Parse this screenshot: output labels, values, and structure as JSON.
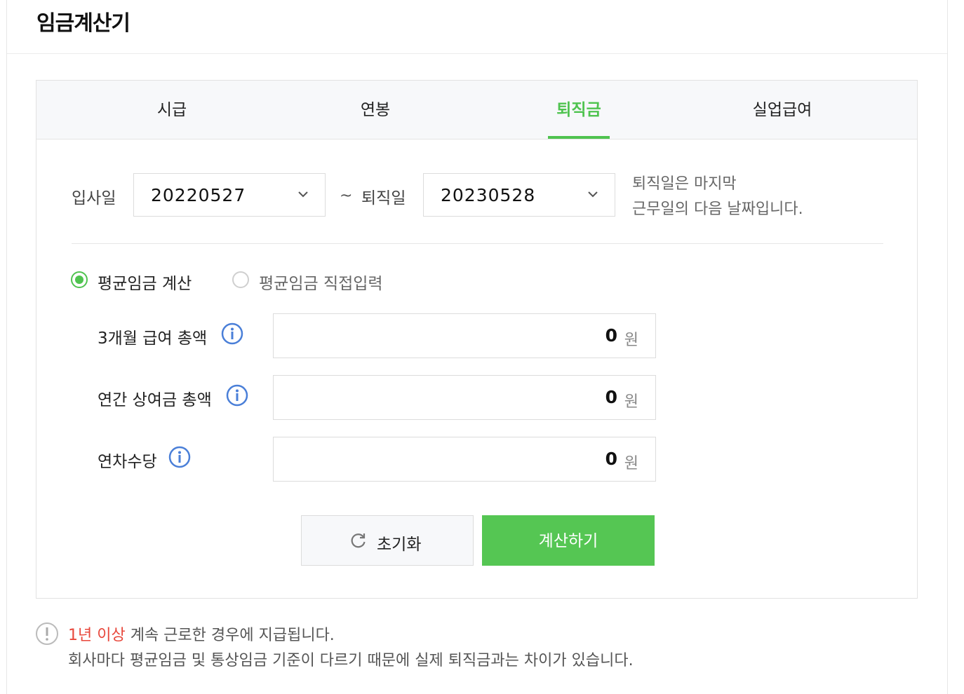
{
  "title": "임금계산기",
  "tabs": [
    {
      "label": "시급",
      "active": false
    },
    {
      "label": "연봉",
      "active": false
    },
    {
      "label": "퇴직금",
      "active": true
    },
    {
      "label": "실업급여",
      "active": false
    }
  ],
  "dates": {
    "start_label": "입사일",
    "start_value": "20220527",
    "tilde": "~",
    "end_label": "퇴직일",
    "end_value": "20230528",
    "note_line1": "퇴직일은 마지막",
    "note_line2": "근무일의 다음 날짜입니다."
  },
  "mode": {
    "option1": "평균임금 계산",
    "option2": "평균임금 직접입력",
    "selected": "option1"
  },
  "fields": [
    {
      "label": "3개월 급여 총액",
      "value": "0",
      "unit": "원"
    },
    {
      "label": "연간 상여금 총액",
      "value": "0",
      "unit": "원"
    },
    {
      "label": "연차수당",
      "value": "0",
      "unit": "원"
    }
  ],
  "buttons": {
    "reset": "초기화",
    "calculate": "계산하기"
  },
  "notice": {
    "highlight": "1년 이상",
    "line1_rest": " 계속 근로한 경우에 지급됩니다.",
    "line2": "회사마다 평균임금 및 통상임금 기준이 다르기 때문에 실제 퇴직금과는 차이가 있습니다."
  },
  "colors": {
    "accent": "#4fc34f",
    "warning": "#e8473b"
  }
}
